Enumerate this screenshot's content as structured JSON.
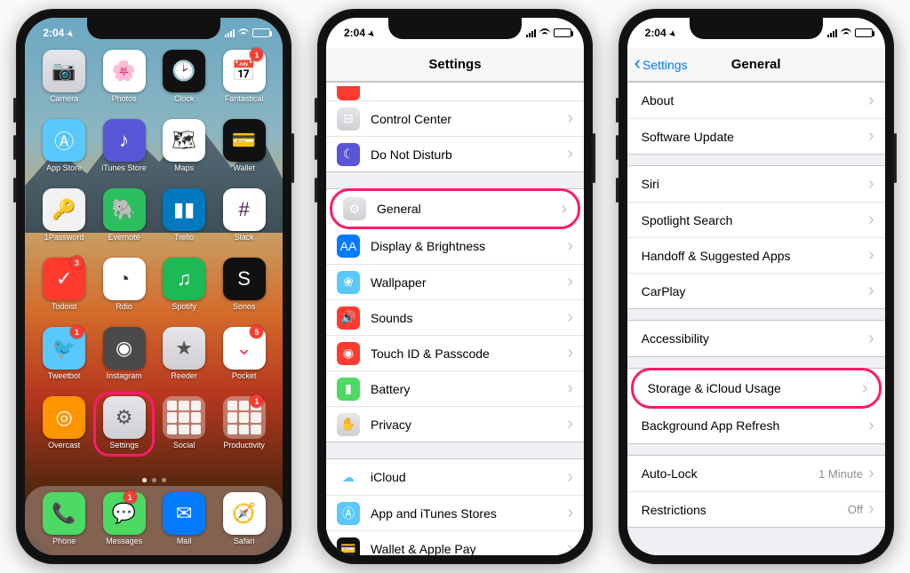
{
  "status": {
    "time": "2:04",
    "carrier_bars": 4,
    "wifi": true,
    "battery_pct": 88
  },
  "phone1": {
    "apps": [
      {
        "name": "Camera",
        "key": "camera",
        "cls": "c-gray",
        "glyph": "📷"
      },
      {
        "name": "Photos",
        "key": "photos",
        "cls": "c-white",
        "glyph": "🌸"
      },
      {
        "name": "Clock",
        "key": "clock",
        "cls": "c-black",
        "glyph": "🕑"
      },
      {
        "name": "Fantastical",
        "key": "fantastical",
        "cls": "c-white",
        "glyph": "📅",
        "badge": "1"
      },
      {
        "name": "App Store",
        "key": "appstore",
        "cls": "c-ltblue",
        "glyph": "Ⓐ"
      },
      {
        "name": "iTunes Store",
        "key": "itunes",
        "cls": "c-purple",
        "glyph": "♪"
      },
      {
        "name": "Maps",
        "key": "maps",
        "cls": "c-white",
        "glyph": "🗺"
      },
      {
        "name": "Wallet",
        "key": "wallet",
        "cls": "c-black",
        "glyph": "💳"
      },
      {
        "name": "1Password",
        "key": "1password",
        "cls": "c-1pw",
        "glyph": "🔑"
      },
      {
        "name": "Evernote",
        "key": "evernote",
        "cls": "c-evernote",
        "glyph": "🐘"
      },
      {
        "name": "Trello",
        "key": "trello",
        "cls": "c-trello",
        "glyph": "▮▮"
      },
      {
        "name": "Slack",
        "key": "slack",
        "cls": "c-slack",
        "glyph": "#"
      },
      {
        "name": "Todoist",
        "key": "todoist",
        "cls": "c-red",
        "glyph": "✓",
        "badge": "3"
      },
      {
        "name": "Rdio",
        "key": "rdio",
        "cls": "c-white",
        "glyph": "◔"
      },
      {
        "name": "Spotify",
        "key": "spotify",
        "cls": "c-spotify",
        "glyph": "♫"
      },
      {
        "name": "Sonos",
        "key": "sonos",
        "cls": "c-black",
        "glyph": "S"
      },
      {
        "name": "Tweetbot",
        "key": "tweetbot",
        "cls": "c-ltblue",
        "glyph": "🐦",
        "badge": "1"
      },
      {
        "name": "Instagram",
        "key": "instagram",
        "cls": "c-dkgray",
        "glyph": "◉"
      },
      {
        "name": "Reeder",
        "key": "reeder",
        "cls": "c-gray",
        "glyph": "★"
      },
      {
        "name": "Pocket",
        "key": "pocket",
        "cls": "c-pocket",
        "glyph": "⌄",
        "badge": "5"
      },
      {
        "name": "Overcast",
        "key": "overcast",
        "cls": "c-orange",
        "glyph": "◎"
      },
      {
        "name": "Settings",
        "key": "settings",
        "cls": "c-gray",
        "glyph": "⚙",
        "highlight": true
      },
      {
        "name": "Social",
        "key": "social",
        "folder": true
      },
      {
        "name": "Productivity",
        "key": "productivity",
        "folder": true,
        "badge": "1"
      }
    ],
    "page_dots": 3,
    "page_dot_active": 0,
    "dock": [
      {
        "name": "Phone",
        "key": "phone",
        "cls": "c-green",
        "glyph": "📞"
      },
      {
        "name": "Messages",
        "key": "messages",
        "cls": "c-green",
        "glyph": "💬",
        "badge": "1"
      },
      {
        "name": "Mail",
        "key": "mail",
        "cls": "c-blue",
        "glyph": "✉"
      },
      {
        "name": "Safari",
        "key": "safari",
        "cls": "c-white",
        "glyph": "🧭"
      }
    ]
  },
  "phone2": {
    "title": "Settings",
    "rows": [
      {
        "peek": true,
        "icon_cls": "c-red",
        "key": "airplane"
      },
      {
        "label": "Control Center",
        "icon_cls": "c-gray",
        "glyph": "⊟",
        "key": "control-center"
      },
      {
        "label": "Do Not Disturb",
        "icon_cls": "c-purple",
        "glyph": "☾",
        "key": "dnd"
      },
      {
        "gap": true
      },
      {
        "label": "General",
        "icon_cls": "c-gray",
        "glyph": "⚙",
        "key": "general",
        "highlight": true
      },
      {
        "label": "Display & Brightness",
        "icon_cls": "c-blue",
        "glyph": "AA",
        "key": "display"
      },
      {
        "label": "Wallpaper",
        "icon_cls": "c-ltblue",
        "glyph": "❀",
        "key": "wallpaper"
      },
      {
        "label": "Sounds",
        "icon_cls": "c-red",
        "glyph": "🔊",
        "key": "sounds"
      },
      {
        "label": "Touch ID & Passcode",
        "icon_cls": "c-red",
        "glyph": "◉",
        "key": "touchid"
      },
      {
        "label": "Battery",
        "icon_cls": "c-green",
        "glyph": "▮",
        "key": "battery"
      },
      {
        "label": "Privacy",
        "icon_cls": "c-gray",
        "glyph": "✋",
        "key": "privacy"
      },
      {
        "gap": true
      },
      {
        "label": "iCloud",
        "icon_cls": "c-white",
        "glyph": "☁",
        "key": "icloud",
        "icon_fg": "#5ac8fa"
      },
      {
        "label": "App and iTunes Stores",
        "icon_cls": "c-ltblue",
        "glyph": "Ⓐ",
        "key": "stores"
      },
      {
        "label": "Wallet & Apple Pay",
        "icon_cls": "c-black",
        "glyph": "💳",
        "key": "wallet-pay"
      }
    ]
  },
  "phone3": {
    "title": "General",
    "back": "Settings",
    "groups": [
      [
        {
          "label": "About",
          "key": "about"
        },
        {
          "label": "Software Update",
          "key": "software-update"
        }
      ],
      [
        {
          "label": "Siri",
          "key": "siri"
        },
        {
          "label": "Spotlight Search",
          "key": "spotlight"
        },
        {
          "label": "Handoff & Suggested Apps",
          "key": "handoff"
        },
        {
          "label": "CarPlay",
          "key": "carplay"
        }
      ],
      [
        {
          "label": "Accessibility",
          "key": "accessibility"
        }
      ],
      [
        {
          "label": "Storage & iCloud Usage",
          "key": "storage",
          "highlight": true
        },
        {
          "label": "Background App Refresh",
          "key": "bg-refresh"
        }
      ],
      [
        {
          "label": "Auto-Lock",
          "key": "auto-lock",
          "value": "1 Minute"
        },
        {
          "label": "Restrictions",
          "key": "restrictions",
          "value": "Off"
        }
      ]
    ]
  }
}
